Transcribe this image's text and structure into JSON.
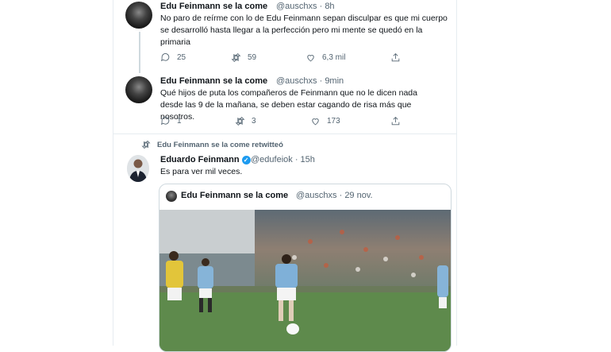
{
  "tweets": [
    {
      "name": "Edu Feinmann se la come",
      "handle": "@auschxs",
      "time": "· 8h",
      "text": "No paro de reírme con lo de Edu Feinmann sepan disculpar es que mi cuerpo se desarrolló hasta llegar a la perfección pero mi mente se quedó en la primaria",
      "replies": "25",
      "retweets": "59",
      "likes": "6,3 mil"
    },
    {
      "name": "Edu Feinmann se la come",
      "handle": "@auschxs",
      "time": "· 9min",
      "text": "Qué hijos de puta los compañeros de Feinmann que no le dicen nada desde las 9 de la mañana, se deben estar cagando de risa más que nosotros.",
      "replies": "1",
      "retweets": "3",
      "likes": "173"
    }
  ],
  "retweet": {
    "label": "Edu Feinmann se la come retwitteó",
    "name": "Eduardo Feinmann",
    "handle": "@edufeiok",
    "time": "· 15h",
    "text": "Es para ver mil veces.",
    "quote": {
      "name": "Edu Feinmann se la come",
      "handle": "@auschxs",
      "time": "· 29 nov."
    }
  },
  "colors": {
    "accent": "#1d9bf0",
    "muted": "#536471",
    "border": "#e6ecf0"
  }
}
